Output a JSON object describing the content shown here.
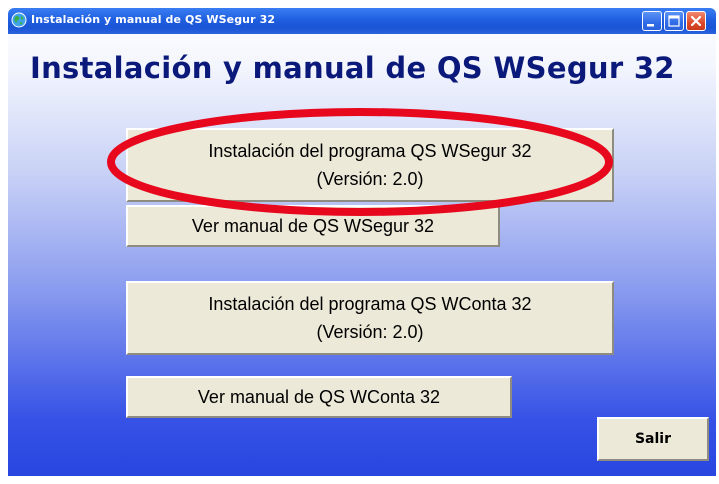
{
  "window": {
    "title": "Instalación y manual de QS WSegur 32"
  },
  "heading": "Instalación y manual de QS WSegur 32",
  "buttons": {
    "install_wsegur": {
      "line1": "Instalación del programa QS WSegur 32",
      "line2": "(Versión: 2.0)"
    },
    "manual_wsegur": "Ver manual de QS WSegur 32",
    "install_wconta": {
      "line1": "Instalación del programa QS WConta 32",
      "line2": "(Versión: 2.0)"
    },
    "manual_wconta": "Ver manual de QS WConta 32",
    "salir": "Salir"
  },
  "colors": {
    "highlight": "#e8081e",
    "heading": "#0b1a7a",
    "titlebar": "#1f5fe0"
  },
  "icons": {
    "app": "globe-icon",
    "minimize": "minimize-icon",
    "maximize": "maximize-icon",
    "close": "close-icon"
  }
}
